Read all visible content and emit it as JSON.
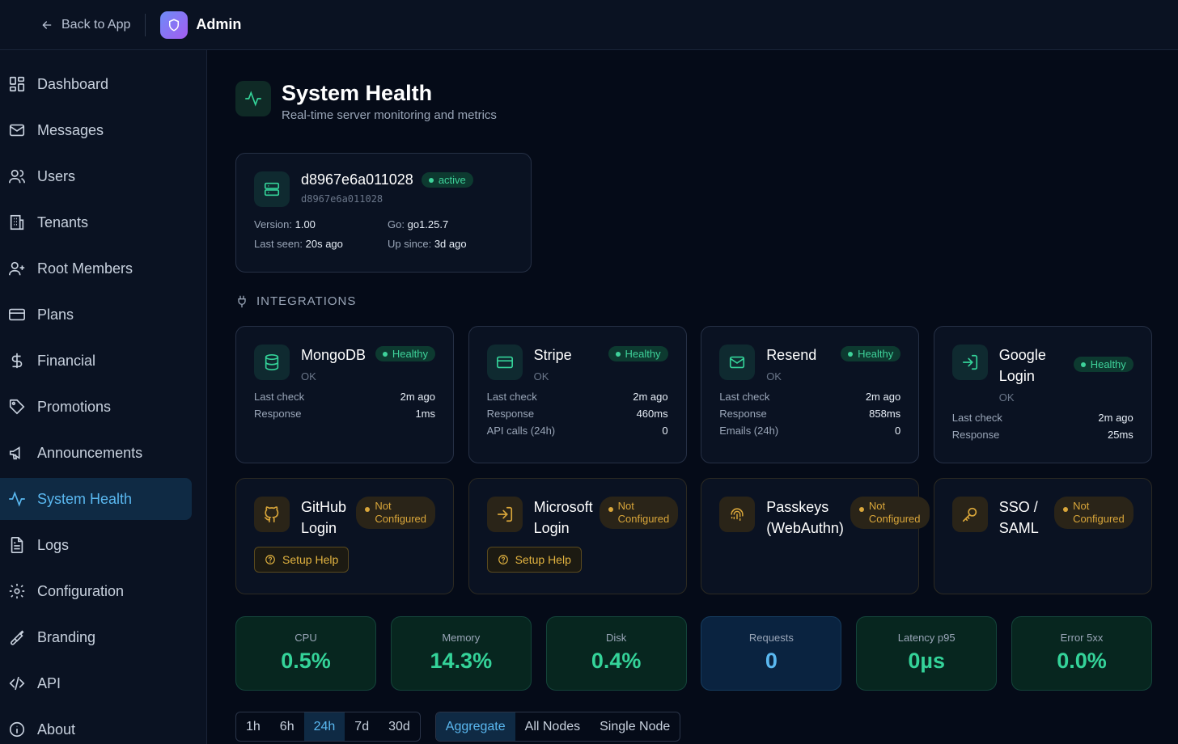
{
  "topbar": {
    "back_label": "Back to App",
    "brand": "Admin"
  },
  "sidebar": {
    "items": [
      {
        "label": "Dashboard",
        "icon": "dashboard-icon"
      },
      {
        "label": "Messages",
        "icon": "mail-icon"
      },
      {
        "label": "Users",
        "icon": "users-icon"
      },
      {
        "label": "Tenants",
        "icon": "building-icon"
      },
      {
        "label": "Root Members",
        "icon": "user-plus-icon"
      },
      {
        "label": "Plans",
        "icon": "card-icon"
      },
      {
        "label": "Financial",
        "icon": "dollar-icon"
      },
      {
        "label": "Promotions",
        "icon": "tag-icon"
      },
      {
        "label": "Announcements",
        "icon": "megaphone-icon"
      },
      {
        "label": "System Health",
        "icon": "activity-icon",
        "active": true
      },
      {
        "label": "Logs",
        "icon": "file-icon"
      },
      {
        "label": "Configuration",
        "icon": "gear-icon"
      },
      {
        "label": "Branding",
        "icon": "brush-icon"
      },
      {
        "label": "API",
        "icon": "code-icon"
      },
      {
        "label": "About",
        "icon": "info-icon"
      }
    ]
  },
  "page": {
    "title": "System Health",
    "subtitle": "Real-time server monitoring and metrics"
  },
  "node": {
    "name": "d8967e6a011028",
    "status": "active",
    "id": "d8967e6a011028",
    "version_label": "Version:",
    "version": "1.00",
    "go_label": "Go:",
    "go": "go1.25.7",
    "last_seen_label": "Last seen:",
    "last_seen": "20s ago",
    "up_since_label": "Up since:",
    "up_since": "3d ago"
  },
  "integrations_label": "INTEGRATIONS",
  "integrations": {
    "mongodb": {
      "name": "MongoDB",
      "badge": "Healthy",
      "status": "OK",
      "last_check_label": "Last check",
      "last_check": "2m ago",
      "response_label": "Response",
      "response": "1ms"
    },
    "stripe": {
      "name": "Stripe",
      "badge": "Healthy",
      "status": "OK",
      "last_check_label": "Last check",
      "last_check": "2m ago",
      "response_label": "Response",
      "response": "460ms",
      "extra_label": "API calls (24h)",
      "extra": "0"
    },
    "resend": {
      "name": "Resend",
      "badge": "Healthy",
      "status": "OK",
      "last_check_label": "Last check",
      "last_check": "2m ago",
      "response_label": "Response",
      "response": "858ms",
      "extra_label": "Emails (24h)",
      "extra": "0"
    },
    "google": {
      "name_l1": "Google",
      "name_l2": "Login",
      "badge": "Healthy",
      "status": "OK",
      "last_check_label": "Last check",
      "last_check": "2m ago",
      "response_label": "Response",
      "response": "25ms"
    },
    "github": {
      "name_l1": "GitHub",
      "name_l2": "Login",
      "badge_l1": "Not",
      "badge_l2": "Configured",
      "button": "Setup Help"
    },
    "microsoft": {
      "name_l1": "Microsoft",
      "name_l2": "Login",
      "badge_l1": "Not",
      "badge_l2": "Configured",
      "button": "Setup Help"
    },
    "passkeys": {
      "name_l1": "Passkeys",
      "name_l2": "(WebAuthn)",
      "badge_l1": "Not",
      "badge_l2": "Configured"
    },
    "sso": {
      "name_l1": "SSO /",
      "name_l2": "SAML",
      "badge_l1": "Not",
      "badge_l2": "Configured"
    }
  },
  "metrics": [
    {
      "label": "CPU",
      "value": "0.5%"
    },
    {
      "label": "Memory",
      "value": "14.3%"
    },
    {
      "label": "Disk",
      "value": "0.4%"
    },
    {
      "label": "Requests",
      "value": "0"
    },
    {
      "label": "Latency p95",
      "value": "0µs"
    },
    {
      "label": "Error 5xx",
      "value": "0.0%"
    }
  ],
  "ranges": [
    "1h",
    "6h",
    "24h",
    "7d",
    "30d"
  ],
  "views": [
    "Aggregate",
    "All Nodes",
    "Single Node"
  ],
  "colors": {
    "accent_green": "#34d399",
    "accent_blue": "#5ab8f0",
    "amber": "#d9a63a",
    "bg": "#050b18"
  }
}
